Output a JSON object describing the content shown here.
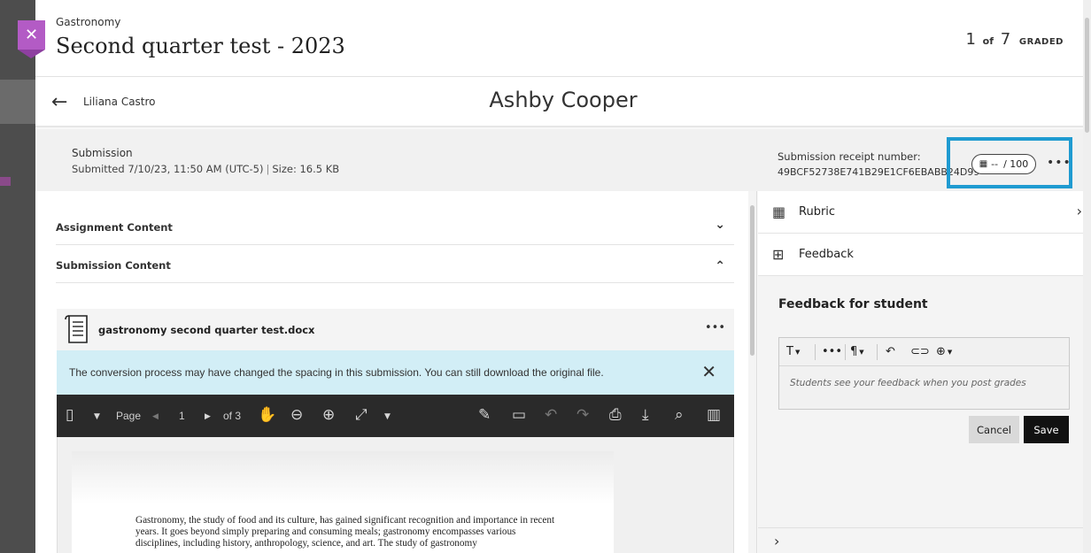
{
  "header": {
    "course": "Gastronomy",
    "title": "Second quarter test - 2023",
    "position": "1",
    "of_label": "of",
    "total": "7",
    "status": "GRADED"
  },
  "student_nav": {
    "previous_student": "Liliana Castro",
    "current_student": "Ashby Cooper"
  },
  "submission": {
    "heading": "Submission",
    "submitted": "Submitted 7/10/23, 11:50 AM (UTC-5)",
    "separator": "|",
    "size": "Size: 16.5 KB",
    "receipt_label": "Submission receipt number:",
    "receipt_number": "49BCF52738E741B29E1CF6EBABB24D99"
  },
  "grade": {
    "score": "--",
    "max": "/ 100"
  },
  "sections": {
    "assignment_content": "Assignment Content",
    "submission_content": "Submission Content"
  },
  "file": {
    "name": "gastronomy second quarter test.docx",
    "notice": "The conversion process may have changed the spacing in this submission. You can still download the original file."
  },
  "viewer": {
    "page_label": "Page",
    "current_page": "1",
    "of_pages": "of 3"
  },
  "document": {
    "text": "Gastronomy, the study of food and its culture, has gained significant recognition and importance in recent years. It goes beyond simply preparing and consuming meals; gastronomy encompasses various disciplines, including history, anthropology, science, and art. The study of gastronomy"
  },
  "right_panel": {
    "rubric_label": "Rubric",
    "feedback_label": "Feedback",
    "feedback_title": "Feedback for student",
    "placeholder": "Students see your feedback when you post grades",
    "cancel_label": "Cancel",
    "save_label": "Save"
  },
  "colors": {
    "accent_close": "#b35bc5",
    "highlight_border": "#1f9bd1",
    "notice_bg": "#d2eef6",
    "viewer_bar": "#2a2a2a"
  },
  "icons": [
    "close-icon",
    "back-arrow-icon",
    "more-icon",
    "rubric-icon",
    "chevron-down-icon",
    "chevron-up-icon",
    "chevron-right-icon",
    "document-icon",
    "feedback-plus-icon",
    "text-format-icon",
    "paragraph-icon",
    "undo-icon",
    "link-icon",
    "insert-icon",
    "hand-icon",
    "zoom-in-icon",
    "zoom-out-icon",
    "fit-icon",
    "annotate-icon",
    "comment-icon",
    "print-icon",
    "download-icon",
    "search-icon"
  ]
}
